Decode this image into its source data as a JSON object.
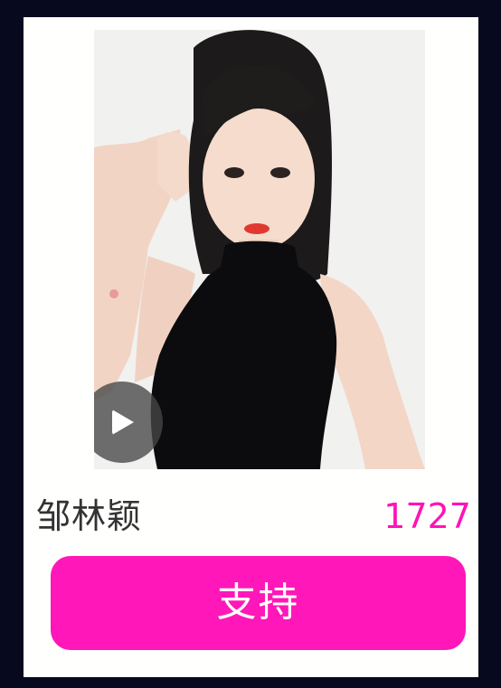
{
  "candidate": {
    "name": "邹林颖",
    "votes": "1727",
    "photo": "portrait-photo",
    "play_icon": "play-icon"
  },
  "actions": {
    "support_label": "支持"
  },
  "colors": {
    "background": "#070a1e",
    "card": "#fffffe",
    "accent": "#ff17b9",
    "votes_text": "#ff13b8",
    "name_text": "#333333"
  }
}
